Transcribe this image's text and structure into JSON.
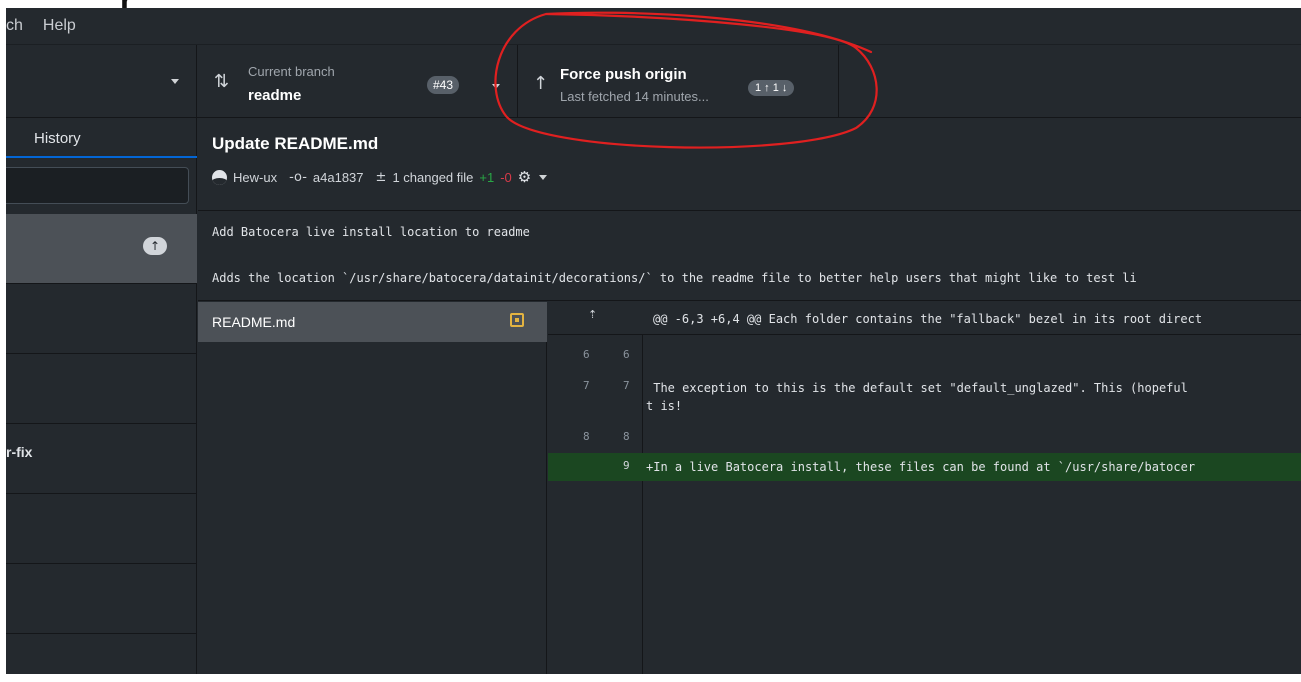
{
  "menubar": {
    "items": [
      "ch",
      "Help"
    ]
  },
  "toolbar": {
    "current_branch_label": "Current branch",
    "current_branch": "readme",
    "pr_badge": "#43",
    "push_title": "Force push origin",
    "push_subtitle": "Last fetched 14 minutes...",
    "push_counts": "1 ↑ 1 ↓"
  },
  "left_pane": {
    "tab_history": "History",
    "commits": [
      {
        "label": ""
      },
      {
        "label": ""
      },
      {
        "label": ""
      },
      {
        "label": "r-fix"
      },
      {
        "label": ""
      },
      {
        "label": ""
      }
    ],
    "push_pill": "↑"
  },
  "commit": {
    "title": "Update README.md",
    "author": "Hew-ux",
    "sha": "a4a1837",
    "changed": "1 changed file",
    "added": "+1",
    "removed": "-0",
    "description_line1": "Add Batocera live install location to readme",
    "description_line2": "Adds the location `/usr/share/batocera/datainit/decorations/` to the readme file to better help users that might like to test li"
  },
  "files": [
    {
      "name": "README.md"
    }
  ],
  "diff": {
    "hunk_header": "@@ -6,3 +6,4 @@ Each folder contains the \"fallback\" bezel in its root direct",
    "lines": [
      {
        "old": "6",
        "new": "6",
        "code": ""
      },
      {
        "old": "7",
        "new": "7",
        "code": " The exception to this is the default set \"default_unglazed\". This (hopeful\nt is!"
      },
      {
        "old": "8",
        "new": "8",
        "code": ""
      },
      {
        "old": "",
        "new": "9",
        "code": "+In a live Batocera install, these files can be found at `/usr/share/batocer"
      }
    ]
  },
  "annotation_color": "#e02020"
}
